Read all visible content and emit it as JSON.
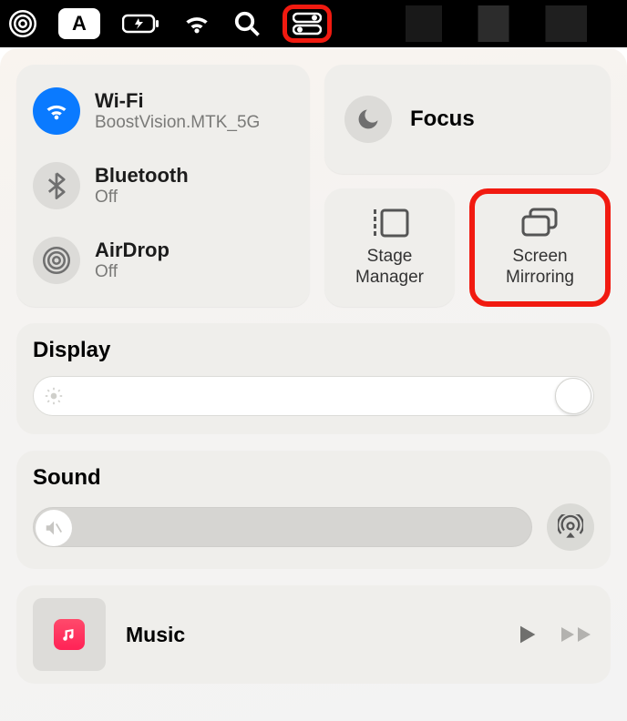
{
  "menubar": {
    "input_source": "A"
  },
  "connectivity": {
    "wifi": {
      "title": "Wi-Fi",
      "sub": "BoostVision.MTK_5G",
      "active": true
    },
    "bluetooth": {
      "title": "Bluetooth",
      "sub": "Off",
      "active": false
    },
    "airdrop": {
      "title": "AirDrop",
      "sub": "Off",
      "active": false
    }
  },
  "focus": {
    "label": "Focus"
  },
  "tiles": {
    "stage_manager": "Stage\nManager",
    "screen_mirroring": "Screen\nMirroring"
  },
  "display": {
    "label": "Display",
    "brightness_pct": 98
  },
  "sound": {
    "label": "Sound",
    "volume_pct": 0
  },
  "music": {
    "label": "Music"
  }
}
